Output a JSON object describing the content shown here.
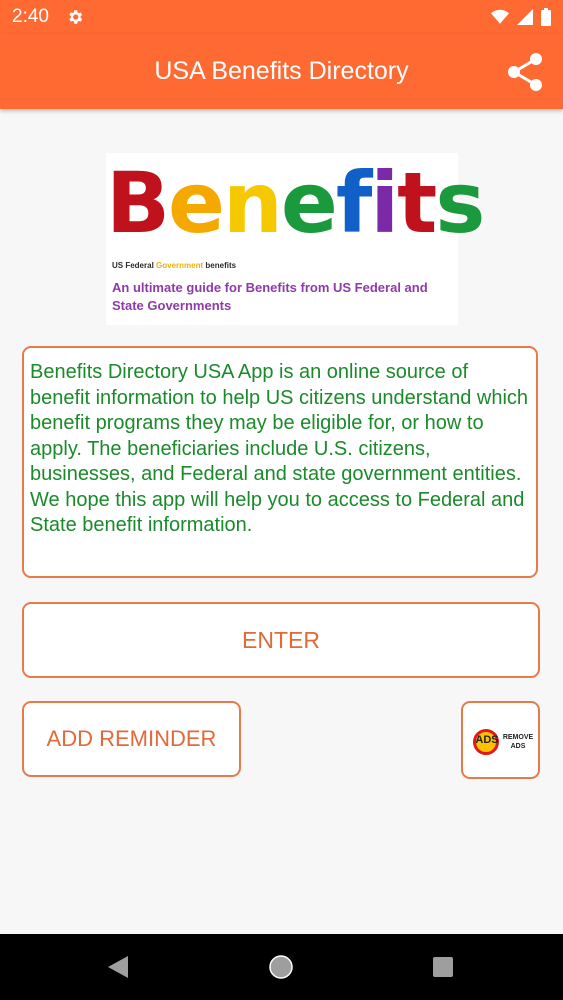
{
  "status_bar": {
    "time": "2:40"
  },
  "app_bar": {
    "title": "USA Benefits Directory"
  },
  "logo": {
    "word_letters": [
      {
        "ch": "B",
        "color": "#c0121c"
      },
      {
        "ch": "e",
        "color": "#f5a800"
      },
      {
        "ch": "n",
        "color": "#f5c800"
      },
      {
        "ch": "e",
        "color": "#1a9a3c"
      },
      {
        "ch": "f",
        "color": "#1060c8"
      },
      {
        "ch": "i",
        "color": "#7a2aa8"
      },
      {
        "ch": "t",
        "color": "#c0121c"
      },
      {
        "ch": "s",
        "color": "#1a9a3c"
      }
    ],
    "subtitle_pre": "US Federal",
    "subtitle_gov": "Government",
    "subtitle_post": "benefits",
    "tagline": "An ultimate guide for Benefits from US Federal and State Governments"
  },
  "description": "Benefits Directory USA App is an online source of benefit information to help US citizens understand which benefit programs they may be eligible for, or how to apply. The beneficiaries include U.S. citizens, businesses, and Federal and state government entities. We hope this app will help you to access to Federal and State benefit information.",
  "buttons": {
    "enter": "ENTER",
    "add_reminder": "ADD REMINDER",
    "remove_ads_badge": "ADS",
    "remove_ads_label": "REMOVE ADS"
  },
  "colors": {
    "accent": "#ff6a33",
    "border": "#e87a4a",
    "button_text": "#e06a3a",
    "description_text": "#1a8a2a"
  }
}
